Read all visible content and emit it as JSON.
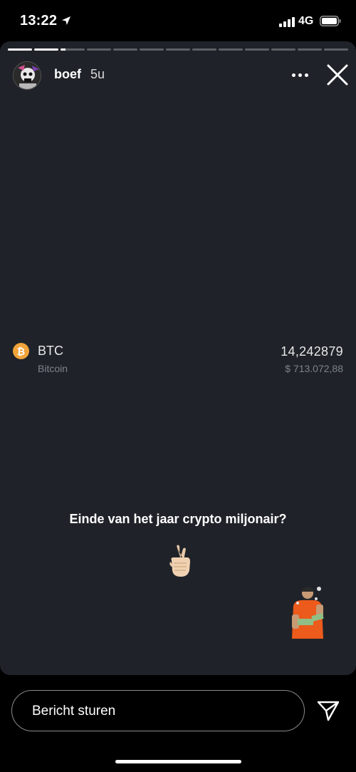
{
  "status_bar": {
    "time": "13:22",
    "network": "4G",
    "location_icon": "location-arrow-icon",
    "signal_icon": "cellular-signal-icon",
    "battery_icon": "battery-icon"
  },
  "story": {
    "username": "boef",
    "time_ago": "5u",
    "segments_total": 13,
    "current_segment": 3,
    "current_segment_progress": 0.2,
    "avatar_icon": "profile-avatar",
    "more_icon": "more-horizontal-icon",
    "close_icon": "close-icon"
  },
  "holding": {
    "ticker": "BTC",
    "name": "Bitcoin",
    "amount": "14,242879",
    "value": "$ 713.072,88",
    "coin_symbol": "₿",
    "coin_color": "#f2a33a"
  },
  "caption": "Einde van het jaar crypto miljonair?",
  "emoji_icon": "crossed-fingers-emoji",
  "sticker_icon": "man-with-money-sticker",
  "composer": {
    "placeholder": "Bericht sturen",
    "send_icon": "send-paper-plane-icon"
  },
  "colors": {
    "background": "#000000",
    "story_background": "#1f2329",
    "muted_text": "#7d838b",
    "accent_orange": "#f2a33a"
  }
}
